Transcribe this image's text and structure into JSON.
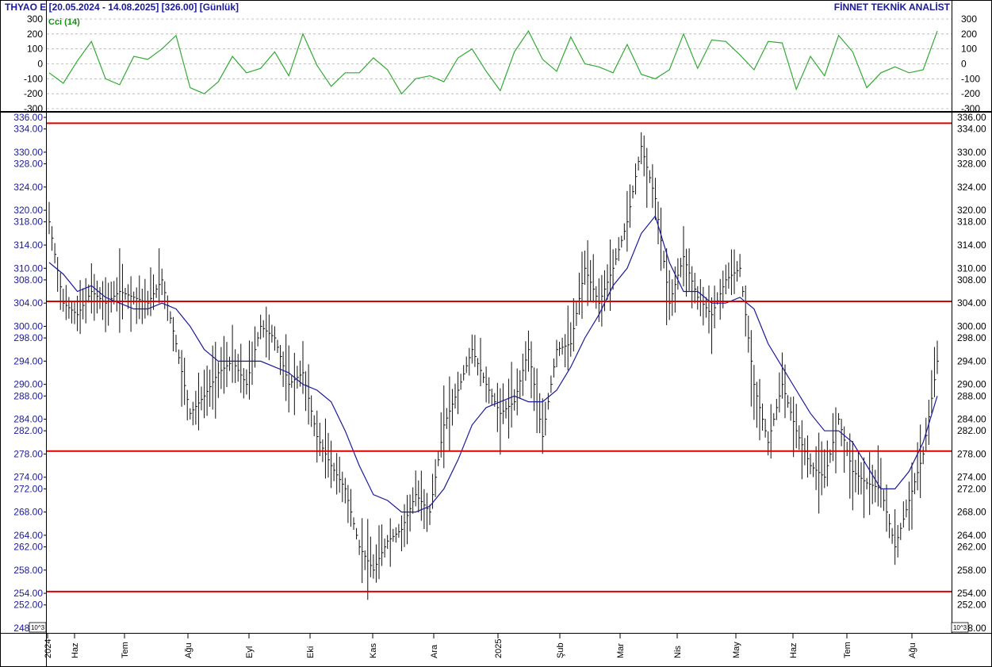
{
  "header": {
    "title": "THYAO E  [20.05.2024 - 14.08.2025]  [326.00]  [Günlük]",
    "brand": "FİNNET TEKNİK ANALİST"
  },
  "chart_data": [
    {
      "type": "line",
      "panel": "indicator",
      "title": "Cci (14)",
      "color": "#33aa33",
      "ylim": [
        -300,
        300
      ],
      "yticks": [
        -300,
        -200,
        -100,
        0,
        100,
        200,
        300
      ],
      "grid": true,
      "series": [
        {
          "name": "Cci (14)",
          "x": [
            0,
            5,
            10,
            15,
            20,
            25,
            30,
            35,
            40,
            45,
            50,
            55,
            60,
            65,
            70,
            75,
            80,
            85,
            90,
            95,
            100,
            105,
            110,
            115,
            120,
            125,
            130,
            135,
            140,
            145,
            150,
            155,
            160,
            165,
            170,
            175,
            180,
            185,
            190,
            195,
            200,
            205,
            210,
            215,
            220,
            225,
            230,
            235,
            240,
            245,
            250,
            255,
            260,
            265,
            270,
            275,
            280,
            285,
            290,
            295,
            300,
            305,
            310,
            315
          ],
          "values": [
            -60,
            -130,
            20,
            150,
            -100,
            -140,
            50,
            30,
            100,
            190,
            -160,
            -200,
            -120,
            50,
            -60,
            -30,
            80,
            -80,
            200,
            -10,
            -150,
            -60,
            -60,
            40,
            -40,
            -200,
            -100,
            -80,
            -120,
            40,
            100,
            -50,
            -180,
            80,
            220,
            30,
            -50,
            180,
            0,
            -20,
            -60,
            130,
            -70,
            -100,
            -40,
            200,
            -30,
            160,
            150,
            60,
            -40,
            150,
            140,
            -170,
            50,
            -80,
            190,
            80,
            -160,
            -60,
            -20,
            -60,
            -40,
            220
          ]
        }
      ]
    },
    {
      "type": "bar",
      "panel": "price",
      "chart_style": "high-low-close bars",
      "xlim": [
        "20.05.2024",
        "14.08.2025"
      ],
      "ylim": [
        248,
        336
      ],
      "yticks": [
        248,
        252,
        254,
        258,
        262,
        264,
        268,
        272,
        274,
        278,
        282,
        284,
        288,
        290,
        294,
        298,
        300,
        304,
        308,
        310,
        314,
        318,
        320,
        324,
        328,
        330,
        334,
        336
      ],
      "x_tick_labels": [
        "2024",
        "Haz",
        "Tem",
        "Ağu",
        "Eyl",
        "Eki",
        "Kas",
        "Ara",
        "2025",
        "Şub",
        "Mar",
        "Nis",
        "May",
        "Haz",
        "Tem",
        "Ağu"
      ],
      "scale_note": "10^3",
      "last_close": 326.0,
      "horizontal_levels": [
        335.0,
        304.3,
        278.5,
        254.3
      ],
      "level_color": "#e00000",
      "bar_color": "#111111",
      "ma_color": "#1a1a9a",
      "series": [
        {
          "name": "price",
          "x": [
            0,
            5,
            10,
            15,
            20,
            25,
            30,
            35,
            40,
            45,
            50,
            55,
            60,
            65,
            70,
            75,
            80,
            85,
            90,
            95,
            100,
            105,
            110,
            115,
            120,
            125,
            130,
            135,
            140,
            145,
            150,
            155,
            160,
            165,
            170,
            175,
            180,
            185,
            190,
            195,
            200,
            205,
            210,
            215,
            220,
            225,
            230,
            235,
            240,
            245,
            250,
            255,
            260,
            265,
            270,
            275,
            280,
            285,
            290,
            295,
            300,
            305,
            310,
            315
          ],
          "values": [
            318,
            304,
            302,
            306,
            304,
            306,
            305,
            304,
            308,
            297,
            285,
            288,
            292,
            294,
            290,
            300,
            298,
            290,
            292,
            281,
            276,
            272,
            262,
            258,
            263,
            265,
            271,
            268,
            283,
            289,
            296,
            290,
            285,
            287,
            296,
            281,
            296,
            297,
            310,
            304,
            310,
            318,
            331,
            322,
            304,
            312,
            305,
            302,
            308,
            310,
            290,
            280,
            290,
            282,
            276,
            274,
            284,
            275,
            273,
            272,
            262,
            270,
            278,
            294
          ]
        },
        {
          "name": "ma",
          "x": [
            0,
            5,
            10,
            15,
            20,
            25,
            30,
            35,
            40,
            45,
            50,
            55,
            60,
            65,
            70,
            75,
            80,
            85,
            90,
            95,
            100,
            105,
            110,
            115,
            120,
            125,
            130,
            135,
            140,
            145,
            150,
            155,
            160,
            165,
            170,
            175,
            180,
            185,
            190,
            195,
            200,
            205,
            210,
            215,
            220,
            225,
            230,
            235,
            240,
            245,
            250,
            255,
            260,
            265,
            270,
            275,
            280,
            285,
            290,
            295,
            300,
            305,
            310,
            315
          ],
          "values": [
            311,
            309,
            306,
            307,
            305,
            304,
            303,
            303,
            304,
            303,
            300,
            296,
            294,
            294,
            294,
            294,
            293,
            292,
            290,
            289,
            287,
            282,
            276,
            271,
            270,
            268,
            268,
            269,
            272,
            277,
            283,
            286,
            287,
            288,
            287,
            287,
            289,
            293,
            298,
            302,
            307,
            310,
            316,
            319,
            311,
            306,
            306,
            304,
            304,
            305,
            303,
            297,
            293,
            289,
            285,
            282,
            282,
            280,
            276,
            272,
            272,
            275,
            280,
            288
          ]
        }
      ]
    }
  ]
}
